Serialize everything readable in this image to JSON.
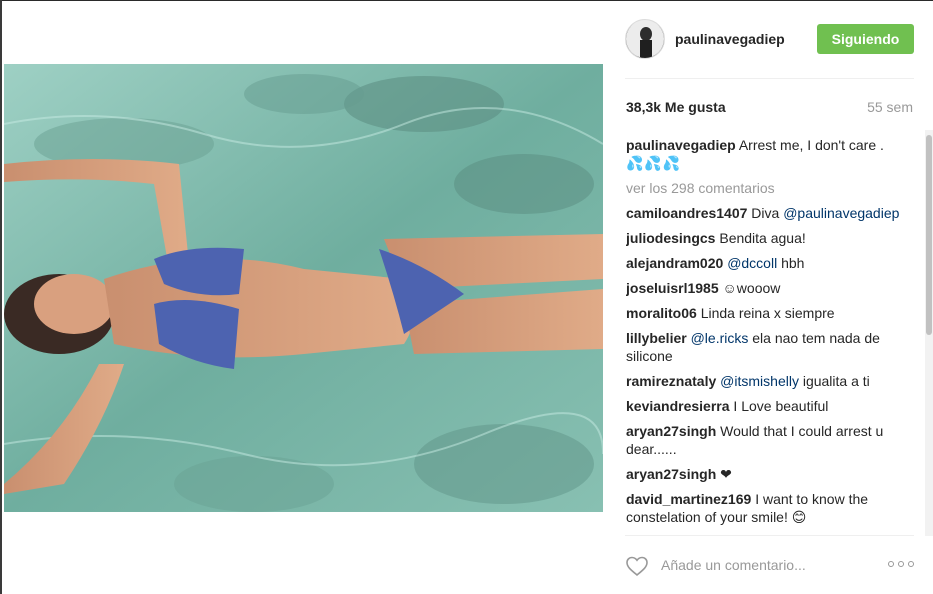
{
  "post": {
    "author": "paulinavegadiep",
    "follow_label": "Siguiendo",
    "likes": "38,3k Me gusta",
    "time_ago": "55 sem",
    "caption": {
      "user": "paulinavegadiep",
      "text": "Arrest me, I don't care .",
      "emoji": "💦💦💦"
    },
    "view_all_comments": "ver los 298 comentarios",
    "comments": [
      {
        "user": "camiloandres1407",
        "text_before": "Diva ",
        "mention": "@paulinavegadiep",
        "text_after": ""
      },
      {
        "user": "juliodesingcs",
        "text_before": "Bendita agua!",
        "mention": "",
        "text_after": ""
      },
      {
        "user": "alejandram020",
        "text_before": "",
        "mention": "@dccoll",
        "text_after": " hbh"
      },
      {
        "user": "joseluisrl1985",
        "text_before": "☺wooow",
        "mention": "",
        "text_after": ""
      },
      {
        "user": "moralito06",
        "text_before": "Linda reina x siempre",
        "mention": "",
        "text_after": ""
      },
      {
        "user": "lillybelier",
        "text_before": "",
        "mention": "@le.ricks",
        "text_after": " ela nao tem nada de silicone"
      },
      {
        "user": "ramireznataly",
        "text_before": "",
        "mention": "@itsmishelly",
        "text_after": " igualita a ti"
      },
      {
        "user": "keviandresierra",
        "text_before": "I Love beautiful",
        "mention": "",
        "text_after": ""
      },
      {
        "user": "aryan27singh",
        "text_before": "Would that I could arrest u dear......",
        "mention": "",
        "text_after": ""
      },
      {
        "user": "aryan27singh",
        "text_before": "❤",
        "mention": "",
        "text_after": ""
      },
      {
        "user": "david_martinez169",
        "text_before": "I want to know the constelation of your smile! 😊",
        "mention": "",
        "text_after": ""
      }
    ],
    "comment_placeholder": "Añade un comentario..."
  },
  "icons": {
    "like": "heart-outline-icon",
    "more": "ellipsis-icon"
  },
  "colors": {
    "follow_button": "#70c050",
    "mention": "#003569",
    "muted": "#999999"
  }
}
